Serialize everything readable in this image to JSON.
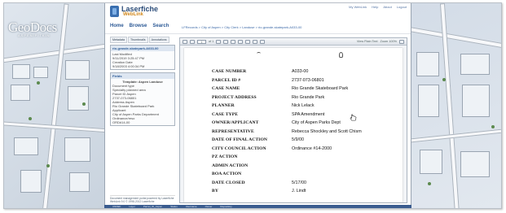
{
  "brand": {
    "map_logo": "GeoDocs",
    "map_logo_sub": "ASPEN/PITKIN",
    "app_name": "Laserfiche",
    "app_sub": "WebLink"
  },
  "user_nav": [
    "My WebLink",
    "Help",
    "About",
    "Logout"
  ],
  "main_nav": [
    "Home",
    "Browse",
    "Search"
  ],
  "breadcrumb": "LFRecords > City of Aspen > City Clerk > Landuse > rio-grande-skatepark-A033-00",
  "side_tabs": [
    "Metadata",
    "Thumbnails",
    "Annotations"
  ],
  "doc_box": {
    "title": "rio-grande-skatepark-A033-00",
    "lines": [
      "Last Modified",
      "9/11/2019 3:25:47 PM",
      "Creation Date",
      "9/18/2003 4:00:34 PM"
    ]
  },
  "fields_box": {
    "title": "Fields",
    "template": "Template: Aspen Landuse",
    "lines": [
      "Document type",
      "Specialty planned area",
      "Parcel ID Aspen",
      "2737-073-06801",
      "Address Aspen",
      "Rio Grande Skateboard Park",
      "Applicant",
      "City of Aspen Parks Department",
      "Ordinance/reso",
      "ORD#14-00"
    ]
  },
  "side_footer": [
    "Document management portal powered by Laserfiche",
    "WebLink 9.0 © 1998-2012 Laserfiche"
  ],
  "viewer_toolbar": {
    "page_value": "1",
    "page_total": "of 1",
    "right_items": [
      "View Plain Text",
      "Zoom 100%"
    ]
  },
  "document": {
    "rows": [
      {
        "label": "CASE NUMBER",
        "value": "A033-00"
      },
      {
        "label": "PARCEL ID #",
        "value": "2737-073-06801"
      },
      {
        "label": "CASE NAME",
        "value": "Rio Grande Skateboard Park"
      },
      {
        "label": "PROJECT ADDRESS",
        "value": "Rio Grande Park"
      },
      {
        "label": "PLANNER",
        "value": "Nick Lelack"
      },
      {
        "label": "CASE TYPE",
        "value": "SPA Amendment"
      },
      {
        "label": "OWNER/APPLICANT",
        "value": "City of Aspen Parks Dept"
      },
      {
        "label": "REPRESENTATIVE",
        "value": "Rebecca Shockley and Scott Chism"
      },
      {
        "label": "DATE OF FINAL ACTION",
        "value": "5/9/00"
      },
      {
        "label": "CITY COUNCIL ACTION",
        "value": "Ordinance #14-2000"
      },
      {
        "label": "PZ ACTION",
        "value": ""
      },
      {
        "label": "ADMIN ACTION",
        "value": ""
      },
      {
        "label": "BOA ACTION",
        "value": ""
      },
      {
        "label": "DATE CLOSED",
        "value": "5/17/00"
      },
      {
        "label": "BY",
        "value": "J. Lindt"
      }
    ]
  },
  "taskbar": [
    "UNDEF",
    "Layer",
    "Parcel_ID_Aspen",
    "Status",
    "Username",
    "Owner",
    "Repository"
  ]
}
